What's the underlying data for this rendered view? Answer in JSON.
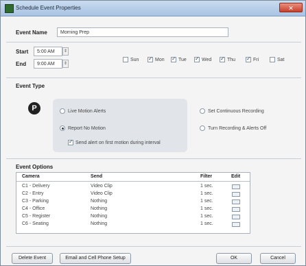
{
  "window": {
    "title": "Schedule Event Properties",
    "close_label": "✕"
  },
  "event_name": {
    "label": "Event Name",
    "value": "Morning Prep"
  },
  "schedule": {
    "start_label": "Start",
    "start_value": "5:00 AM",
    "end_label": "End",
    "end_value": "9:00 AM",
    "days": [
      {
        "label": "Sun",
        "checked": false
      },
      {
        "label": "Mon",
        "checked": true
      },
      {
        "label": "Tue",
        "checked": true
      },
      {
        "label": "Wed",
        "checked": true
      },
      {
        "label": "Thu",
        "checked": true
      },
      {
        "label": "Fri",
        "checked": true
      },
      {
        "label": "Sat",
        "checked": false
      }
    ]
  },
  "event_type": {
    "heading": "Event Type",
    "icon_letter": "P",
    "options": {
      "live_motion": "Live Motion Alerts",
      "report_no_motion": "Report No Motion",
      "send_alert": "Send alert on first motion during interval",
      "continuous": "Set Continuous Recording",
      "turn_off": "Turn Recording & Alerts Off"
    },
    "selected": "report_no_motion",
    "send_alert_checked": true
  },
  "event_options": {
    "heading": "Event Options",
    "columns": {
      "camera": "Camera",
      "send": "Send",
      "filter": "Filter",
      "edit": "Edit"
    },
    "rows": [
      {
        "camera": "C1 - Delivery",
        "send": "Video Clip",
        "filter": "1 sec."
      },
      {
        "camera": "C2 - Entry",
        "send": "Video Clip",
        "filter": "1 sec."
      },
      {
        "camera": "C3 - Parking",
        "send": "Nothing",
        "filter": "1 sec."
      },
      {
        "camera": "C4 - Office",
        "send": "Nothing",
        "filter": "1 sec."
      },
      {
        "camera": "C5 - Register",
        "send": "Nothing",
        "filter": "1 sec."
      },
      {
        "camera": "C6 - Seating",
        "send": "Nothing",
        "filter": "1 sec."
      }
    ]
  },
  "buttons": {
    "delete": "Delete Event",
    "email": "Email and Cell Phone Setup",
    "ok": "OK",
    "cancel": "Cancel"
  }
}
